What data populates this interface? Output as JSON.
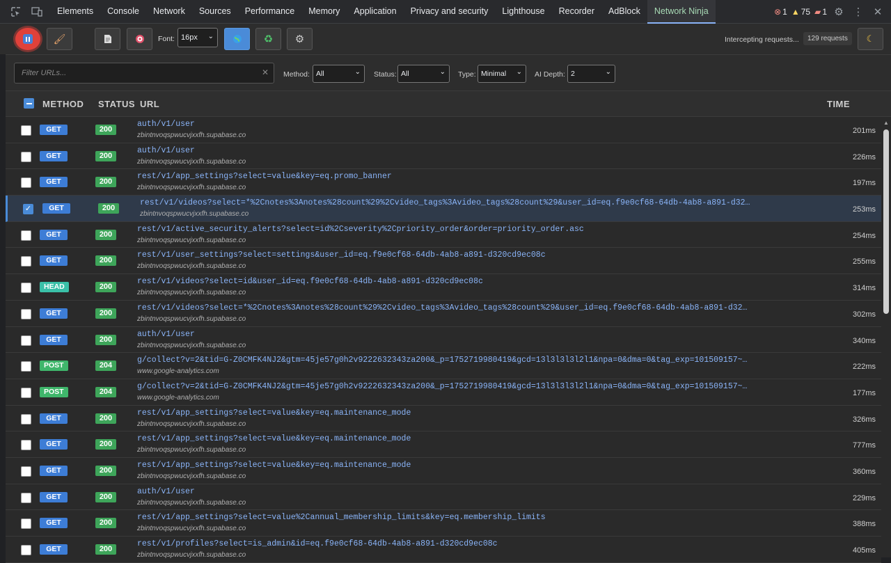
{
  "devtools": {
    "tabs": [
      "Elements",
      "Console",
      "Network",
      "Sources",
      "Performance",
      "Memory",
      "Application",
      "Privacy and security",
      "Lighthouse",
      "Recorder",
      "AdBlock",
      "Network Ninja"
    ],
    "active_tab": "Network Ninja",
    "error_count": "1",
    "warning_count": "75",
    "message_count": "1"
  },
  "toolbar": {
    "font_label": "Font:",
    "font_size": "16px",
    "intercept_label": "Intercepting requests...",
    "request_count": "129 requests"
  },
  "filters": {
    "url_placeholder": "Filter URLs...",
    "method_label": "Method:",
    "method_value": "All",
    "status_label": "Status:",
    "status_value": "All",
    "type_label": "Type:",
    "type_value": "Minimal",
    "ai_depth_label": "AI Depth:",
    "ai_depth_value": "2"
  },
  "table": {
    "headers": {
      "method": "METHOD",
      "status": "STATUS",
      "url": "URL",
      "time": "TIME"
    },
    "rows": [
      {
        "method": "GET",
        "status": "200",
        "url": "auth/v1/user",
        "host": "zbintnvoqspwucvjxxfh.supabase.co",
        "time": "201ms",
        "selected": false
      },
      {
        "method": "GET",
        "status": "200",
        "url": "auth/v1/user",
        "host": "zbintnvoqspwucvjxxfh.supabase.co",
        "time": "226ms",
        "selected": false
      },
      {
        "method": "GET",
        "status": "200",
        "url": "rest/v1/app_settings?select=value&key=eq.promo_banner",
        "host": "zbintnvoqspwucvjxxfh.supabase.co",
        "time": "197ms",
        "selected": false
      },
      {
        "method": "GET",
        "status": "200",
        "url": "rest/v1/videos?select=*%2Cnotes%3Anotes%28count%29%2Cvideo_tags%3Avideo_tags%28count%29&user_id=eq.f9e0cf68-64db-4ab8-a891-d32…",
        "host": "zbintnvoqspwucvjxxfh.supabase.co",
        "time": "253ms",
        "selected": true
      },
      {
        "method": "GET",
        "status": "200",
        "url": "rest/v1/active_security_alerts?select=id%2Cseverity%2Cpriority_order&order=priority_order.asc",
        "host": "zbintnvoqspwucvjxxfh.supabase.co",
        "time": "254ms",
        "selected": false
      },
      {
        "method": "GET",
        "status": "200",
        "url": "rest/v1/user_settings?select=settings&user_id=eq.f9e0cf68-64db-4ab8-a891-d320cd9ec08c",
        "host": "zbintnvoqspwucvjxxfh.supabase.co",
        "time": "255ms",
        "selected": false
      },
      {
        "method": "HEAD",
        "status": "200",
        "url": "rest/v1/videos?select=id&user_id=eq.f9e0cf68-64db-4ab8-a891-d320cd9ec08c",
        "host": "zbintnvoqspwucvjxxfh.supabase.co",
        "time": "314ms",
        "selected": false
      },
      {
        "method": "GET",
        "status": "200",
        "url": "rest/v1/videos?select=*%2Cnotes%3Anotes%28count%29%2Cvideo_tags%3Avideo_tags%28count%29&user_id=eq.f9e0cf68-64db-4ab8-a891-d32…",
        "host": "zbintnvoqspwucvjxxfh.supabase.co",
        "time": "302ms",
        "selected": false
      },
      {
        "method": "GET",
        "status": "200",
        "url": "auth/v1/user",
        "host": "zbintnvoqspwucvjxxfh.supabase.co",
        "time": "340ms",
        "selected": false
      },
      {
        "method": "POST",
        "status": "204",
        "url": "g/collect?v=2&tid=G-Z0CMFK4NJ2&gtm=45je57g0h2v9222632343za200&_p=1752719980419&gcd=13l3l3l3l2l1&npa=0&dma=0&tag_exp=101509157~…",
        "host": "www.google-analytics.com",
        "time": "222ms",
        "selected": false
      },
      {
        "method": "POST",
        "status": "204",
        "url": "g/collect?v=2&tid=G-Z0CMFK4NJ2&gtm=45je57g0h2v9222632343za200&_p=1752719980419&gcd=13l3l3l3l2l1&npa=0&dma=0&tag_exp=101509157~…",
        "host": "www.google-analytics.com",
        "time": "177ms",
        "selected": false
      },
      {
        "method": "GET",
        "status": "200",
        "url": "rest/v1/app_settings?select=value&key=eq.maintenance_mode",
        "host": "zbintnvoqspwucvjxxfh.supabase.co",
        "time": "326ms",
        "selected": false
      },
      {
        "method": "GET",
        "status": "200",
        "url": "rest/v1/app_settings?select=value&key=eq.maintenance_mode",
        "host": "zbintnvoqspwucvjxxfh.supabase.co",
        "time": "777ms",
        "selected": false
      },
      {
        "method": "GET",
        "status": "200",
        "url": "rest/v1/app_settings?select=value&key=eq.maintenance_mode",
        "host": "zbintnvoqspwucvjxxfh.supabase.co",
        "time": "360ms",
        "selected": false
      },
      {
        "method": "GET",
        "status": "200",
        "url": "auth/v1/user",
        "host": "zbintnvoqspwucvjxxfh.supabase.co",
        "time": "229ms",
        "selected": false
      },
      {
        "method": "GET",
        "status": "200",
        "url": "rest/v1/app_settings?select=value%2Cannual_membership_limits&key=eq.membership_limits",
        "host": "zbintnvoqspwucvjxxfh.supabase.co",
        "time": "388ms",
        "selected": false
      },
      {
        "method": "GET",
        "status": "200",
        "url": "rest/v1/profiles?select=is_admin&id=eq.f9e0cf68-64db-4ab8-a891-d320cd9ec08c",
        "host": "zbintnvoqspwucvjxxfh.supabase.co",
        "time": "405ms",
        "selected": false
      }
    ]
  },
  "colors": {
    "accent": "#4a8bd8",
    "get_badge": "#3d7dd6",
    "post_badge": "#3fb66b",
    "head_badge": "#3ac0a8",
    "status_badge": "#3ea55a",
    "record_button": "#e0413a"
  },
  "icons": {
    "inspect": "inspect-element-icon",
    "device": "device-toolbar-icon",
    "record": "pause-icon",
    "clear": "broom-icon",
    "document": "document-icon",
    "target": "target-icon",
    "globe": "globe-icon",
    "recycle": "recycle-icon",
    "settings": "gear-icon",
    "theme": "moon-icon"
  }
}
